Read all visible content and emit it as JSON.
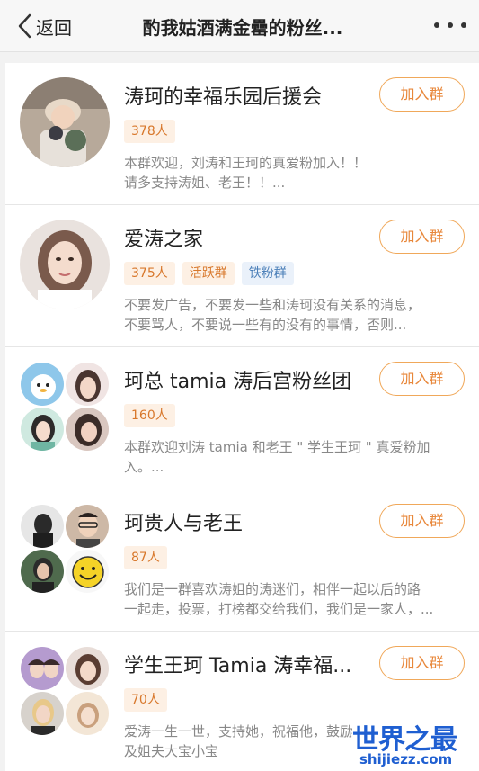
{
  "nav": {
    "back_label": "返回",
    "title": "酌我姑酒满金罍的粉丝..."
  },
  "groups": [
    {
      "name": "涛珂的幸福乐园后援会",
      "join_label": "加入群",
      "count": "378人",
      "extra_tags": [],
      "desc_line1": "本群欢迎，刘涛和王珂的真爱粉加入！！",
      "desc_line2": "请多支持涛姐、老王！！..."
    },
    {
      "name": "爱涛之家",
      "join_label": "加入群",
      "count": "375人",
      "extra_tags": [
        "活跃群",
        "铁粉群"
      ],
      "desc_line1": "不要发广告，不要发一些和涛珂没有关系的消息，",
      "desc_line2": "不要骂人，不要说一些有的没有的事情，否则..."
    },
    {
      "name": "珂总 tamia 涛后宫粉丝团",
      "join_label": "加入群",
      "count": "160人",
      "extra_tags": [],
      "desc_line1": "本群欢迎刘涛 tamia 和老王 \" 学生王珂 \" 真爱粉加",
      "desc_line2": "入。..."
    },
    {
      "name": "珂贵人与老王",
      "join_label": "加入群",
      "count": "87人",
      "extra_tags": [],
      "desc_line1": "我们是一群喜欢涛姐的涛迷们，相伴一起以后的路",
      "desc_line2": "一起走，投票，打榜都交给我们，我们是一家人，..."
    },
    {
      "name": "学生王珂 Tamia 涛幸福...",
      "join_label": "加入群",
      "count": "70人",
      "extra_tags": [],
      "desc_line1": "爱涛一生一世，支持她，祝福他，鼓励",
      "desc_line2": "及姐夫大宝小宝"
    }
  ],
  "watermark": {
    "cn": "世界之最",
    "en": "shijiezz.com"
  },
  "colors": {
    "accent": "#e8873a",
    "tag_bg": "#fdf0e4",
    "iron_tag": "#4b7fb8",
    "watermark": "#1f5fd1"
  }
}
